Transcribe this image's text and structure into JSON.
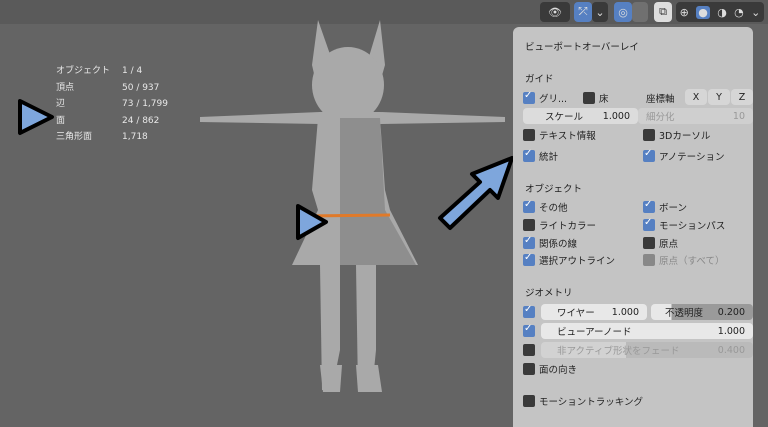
{
  "stats": [
    {
      "label": "オブジェクト",
      "value": "1 / 4"
    },
    {
      "label": "頂点",
      "value": "50 / 937"
    },
    {
      "label": "辺",
      "value": "73 / 1,799"
    },
    {
      "label": "面",
      "value": "24 / 862"
    },
    {
      "label": "三角形面",
      "value": "1,718"
    }
  ],
  "panel": {
    "title": "ビューポートオーバーレイ",
    "guides": {
      "heading": "ガイド",
      "grid": "グリ...",
      "floor": "床",
      "axes": "座標軸",
      "x": "X",
      "y": "Y",
      "z": "Z",
      "scale_label": "スケール",
      "scale_value": "1.000",
      "subdiv_label": "細分化",
      "subdiv_value": "10",
      "text_info": "テキスト情報",
      "cursor": "3Dカーソル",
      "stats": "統計",
      "annotations": "アノテーション"
    },
    "objects": {
      "heading": "オブジェクト",
      "extras": "その他",
      "bones": "ボーン",
      "light_colors": "ライトカラー",
      "motion_paths": "モーションパス",
      "relationship_lines": "関係の線",
      "origins": "原点",
      "outline_selected": "選択アウトライン",
      "origins_all": "原点（すべて）"
    },
    "geometry": {
      "heading": "ジオメトリ",
      "wireframe_label": "ワイヤー",
      "wireframe_value": "1.000",
      "opacity_label": "不透明度",
      "opacity_value": "0.200",
      "viewer_node_label": "ビューアーノード",
      "viewer_node_value": "1.000",
      "fade_label": "非アクティブ形状をフェード",
      "fade_value": "0.400",
      "face_orientation": "面の向き"
    },
    "motion_tracking": "モーショントラッキング"
  },
  "colors": {
    "accent": "#5680c2",
    "panel": "#c4c4c4",
    "viewport": "#646464"
  }
}
